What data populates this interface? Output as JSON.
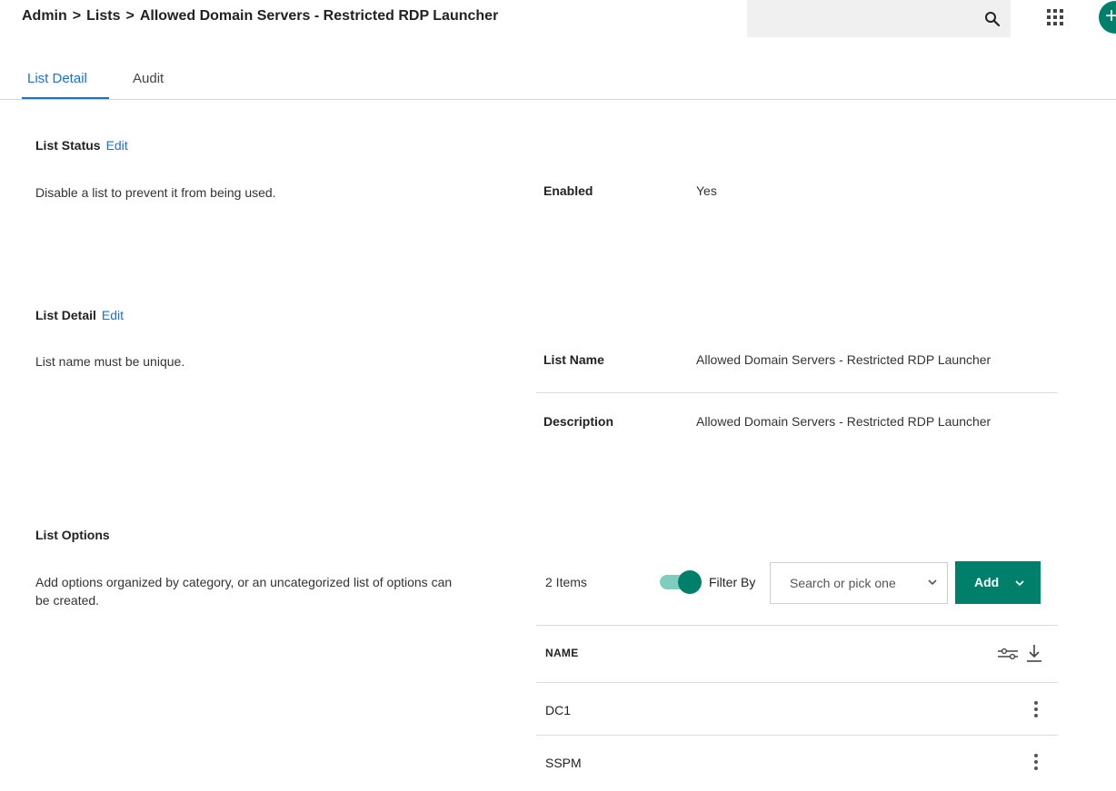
{
  "header": {
    "breadcrumb": [
      "Admin",
      "Lists",
      "Allowed Domain Servers - Restricted RDP Launcher"
    ],
    "breadcrumb_separator": ">",
    "search": {
      "value": "",
      "placeholder": ""
    },
    "create_label": "+"
  },
  "tabs": [
    {
      "label": "List Detail",
      "active": true
    },
    {
      "label": "Audit",
      "active": false
    }
  ],
  "list_status": {
    "title": "List Status",
    "edit_label": "Edit",
    "description": "Disable a list to prevent it from being used.",
    "fields": [
      {
        "label": "Enabled",
        "value": "Yes"
      }
    ]
  },
  "list_detail": {
    "title": "List Detail",
    "edit_label": "Edit",
    "description": "List name must be unique.",
    "fields": [
      {
        "label": "List Name",
        "value": "Allowed Domain Servers - Restricted RDP Launcher"
      },
      {
        "label": "Description",
        "value": "Allowed Domain Servers - Restricted RDP Launcher"
      }
    ]
  },
  "list_options": {
    "title": "List Options",
    "description": "Add options organized by category, or an uncategorized list of options can be created.",
    "items_count": "2 Items",
    "filter_label": "Filter By",
    "filter_enabled": true,
    "filter_placeholder": "Search or pick one",
    "add_label": "Add",
    "table": {
      "columns": [
        "NAME"
      ],
      "rows": [
        {
          "name": "DC1"
        },
        {
          "name": "SSPM"
        }
      ]
    }
  },
  "colors": {
    "accent": "#00806b",
    "link": "#1b6ed4",
    "toggle_track": "#7fcdbf"
  },
  "icons": [
    "search-icon",
    "apps-grid-icon",
    "plus-icon",
    "chevron-down-icon",
    "column-settings-icon",
    "download-icon",
    "more-vertical-icon"
  ]
}
